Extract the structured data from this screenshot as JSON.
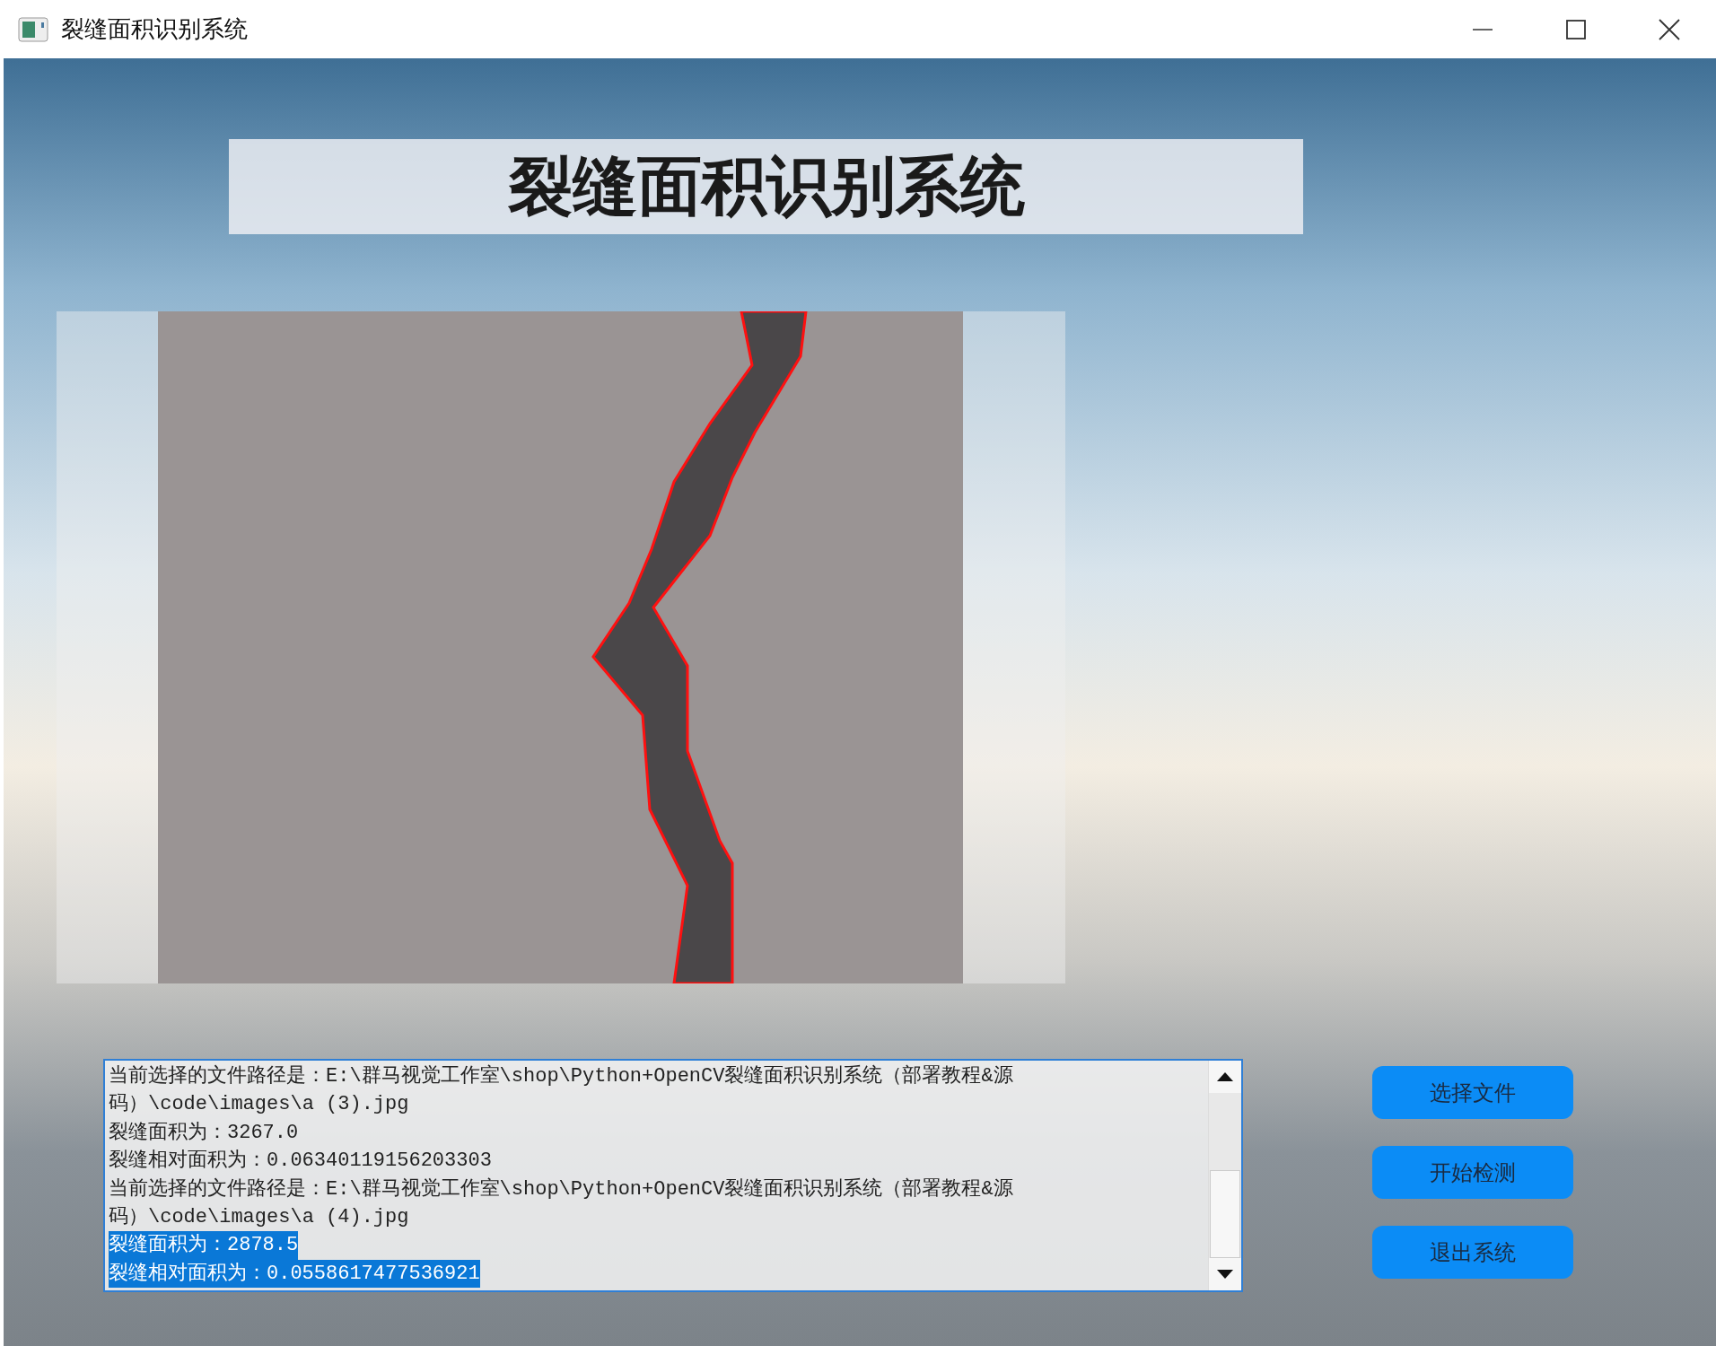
{
  "window": {
    "title": "裂缝面积识别系统"
  },
  "header": {
    "title": "裂缝面积识别系统"
  },
  "log": {
    "lines": [
      {
        "text": "当前选择的文件路径是：E:\\群马视觉工作室\\shop\\Python+OpenCV裂缝面积识别系统（部署教程&源",
        "selected": false
      },
      {
        "text": "码）\\code\\images\\a (3).jpg",
        "selected": false
      },
      {
        "text": "裂缝面积为：3267.0",
        "selected": false
      },
      {
        "text": "裂缝相对面积为：0.06340119156203303",
        "selected": false
      },
      {
        "text": "当前选择的文件路径是：E:\\群马视觉工作室\\shop\\Python+OpenCV裂缝面积识别系统（部署教程&源",
        "selected": false
      },
      {
        "text": "码）\\code\\images\\a (4).jpg",
        "selected": false
      },
      {
        "text": "裂缝面积为：2878.5",
        "selected": true
      },
      {
        "text": "裂缝相对面积为：0.0558617477536921",
        "selected": true
      }
    ]
  },
  "buttons": [
    "选择文件",
    "开始检测",
    "退出系统"
  ]
}
